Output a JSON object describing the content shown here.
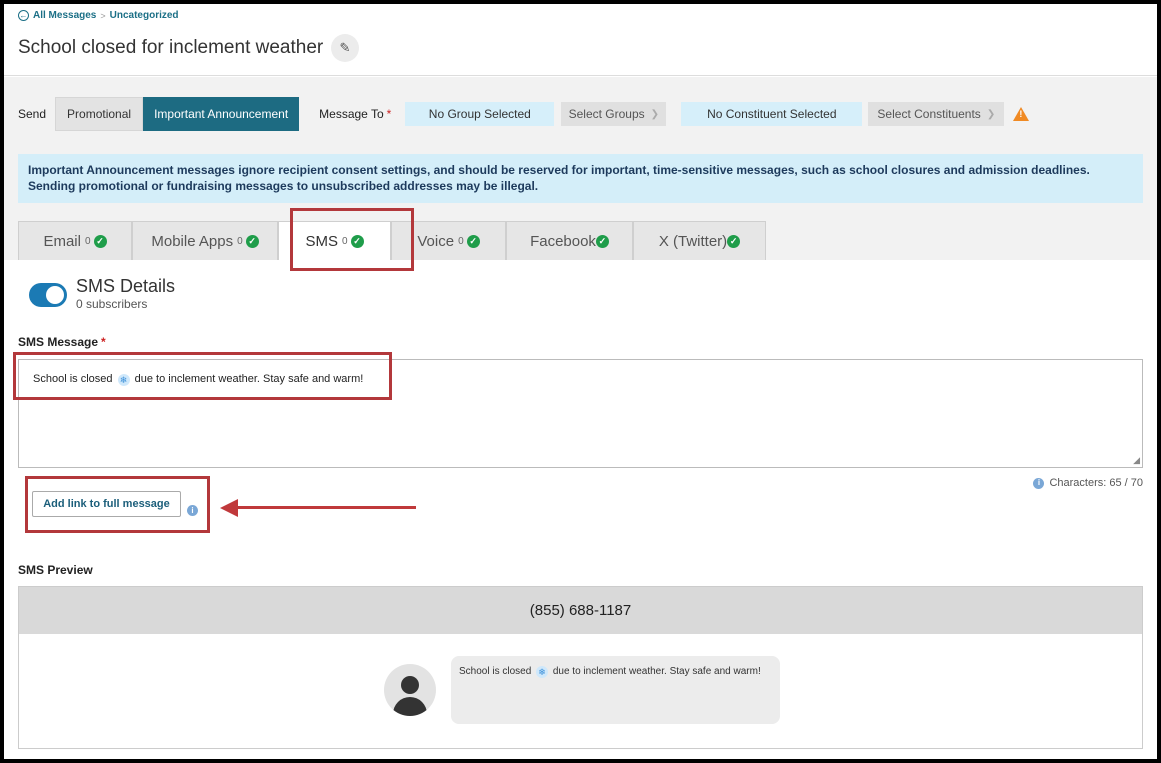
{
  "breadcrumb": {
    "root": "All Messages",
    "current": "Uncategorized"
  },
  "header": {
    "title": "School closed for inclement weather"
  },
  "send": {
    "label": "Send",
    "options": [
      "Promotional",
      "Important Announcement"
    ],
    "selected": "Important Announcement",
    "message_to_label": "Message To",
    "group_status": "No Group Selected",
    "select_groups": "Select Groups",
    "constituent_status": "No Constituent Selected",
    "select_constituents": "Select Constituents"
  },
  "banner": {
    "text": "Important Announcement messages ignore recipient consent settings, and should be reserved for important, time-sensitive messages, such as school closures and admission deadlines. Sending promotional or fundraising messages to unsubscribed addresses may be illegal."
  },
  "tabs": [
    {
      "label": "Email",
      "count": "0"
    },
    {
      "label": "Mobile Apps",
      "count": "0"
    },
    {
      "label": "SMS",
      "count": "0"
    },
    {
      "label": "Voice",
      "count": "0"
    },
    {
      "label": "Facebook",
      "count": ""
    },
    {
      "label": "X (Twitter)",
      "count": ""
    }
  ],
  "active_tab": "SMS",
  "sms": {
    "title": "SMS Details",
    "subscribers": "0 subscribers",
    "enabled": true,
    "message_label": "SMS Message",
    "message_before": "School is closed",
    "message_after": "due to inclement weather. Stay safe and warm!",
    "characters": "Characters: 65 / 70",
    "add_link_label": "Add link to full message",
    "preview_label": "SMS Preview",
    "preview_number": "(855) 688-1187"
  },
  "colors": {
    "primary": "#1d6b82",
    "banner_bg": "#d4eef9",
    "highlight": "#b3383b",
    "success": "#1f9d4a",
    "warning": "#f08a24"
  }
}
